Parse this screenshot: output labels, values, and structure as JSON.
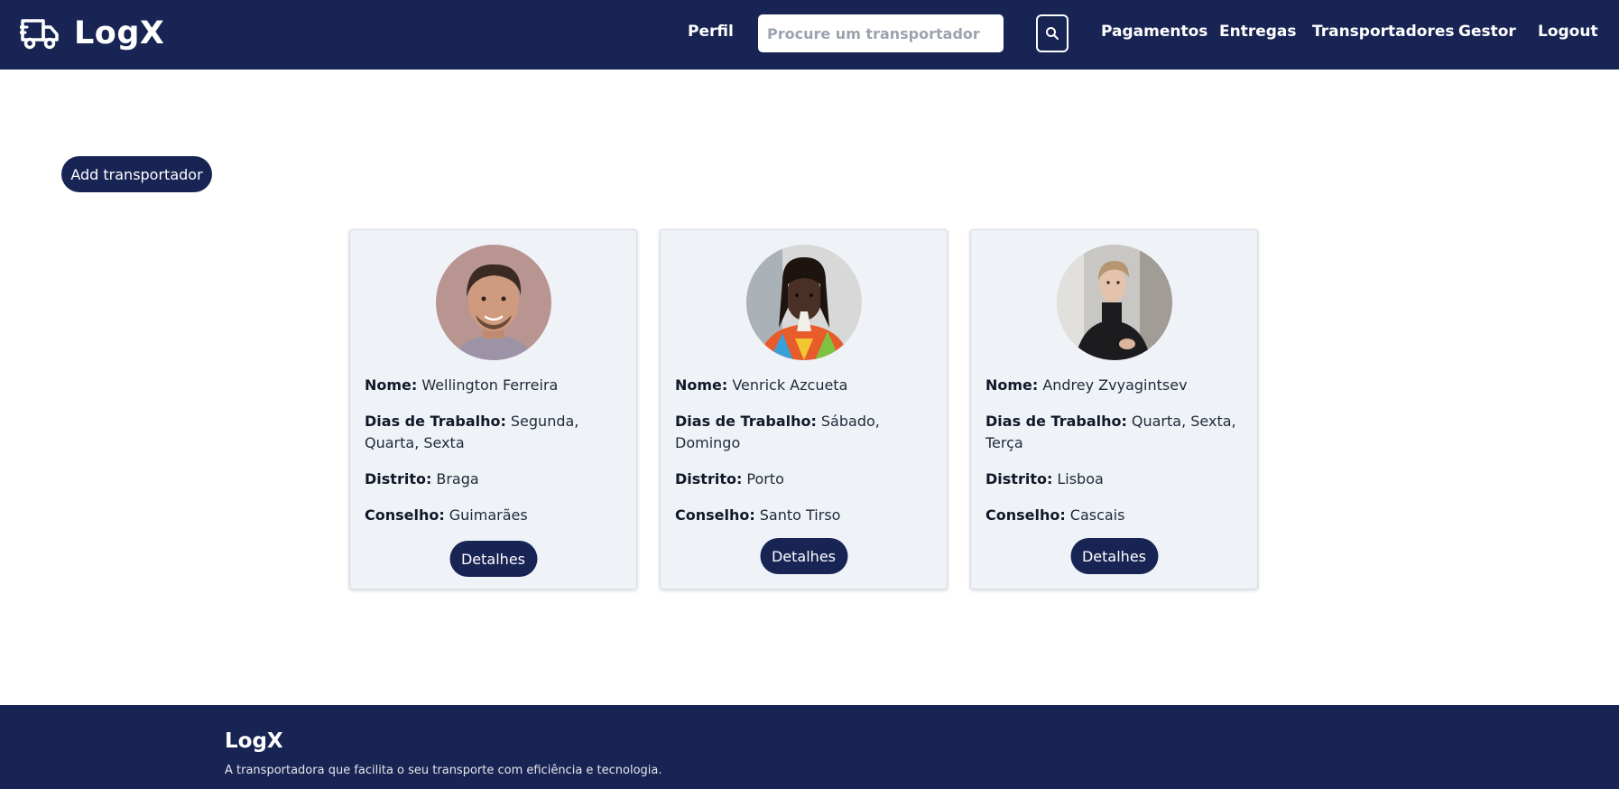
{
  "brand": {
    "name": "LogX",
    "icon": "truck-icon"
  },
  "nav": {
    "profile": "Perfil",
    "search_placeholder": "Procure um transportador",
    "search_icon": "search-icon",
    "payments": "Pagamentos",
    "deliveries": "Entregas",
    "carriers": "Transportadores",
    "manager": "Gestor",
    "logout": "Logout"
  },
  "main": {
    "add_button": "Add transportador",
    "labels": {
      "name": "Nome:",
      "work_days": "Dias de Trabalho:",
      "district": "Distrito:",
      "council": "Conselho:"
    },
    "details_button": "Detalhes",
    "carriers": [
      {
        "name": "Wellington Ferreira",
        "work_days": "Segunda, Quarta, Sexta",
        "district": "Braga",
        "council": "Guimarães"
      },
      {
        "name": "Venrick Azcueta",
        "work_days": "Sábado, Domingo",
        "district": "Porto",
        "council": "Santo Tirso"
      },
      {
        "name": "Andrey Zvyagintsev",
        "work_days": "Quarta, Sexta, Terça",
        "district": "Lisboa",
        "council": "Cascais"
      }
    ]
  },
  "footer": {
    "title": "LogX",
    "tagline": "A transportadora que facilita o seu transporte com eficiência e tecnologia."
  },
  "colors": {
    "primary": "#182454",
    "card_bg": "#eff3f8",
    "white": "#ffffff"
  }
}
